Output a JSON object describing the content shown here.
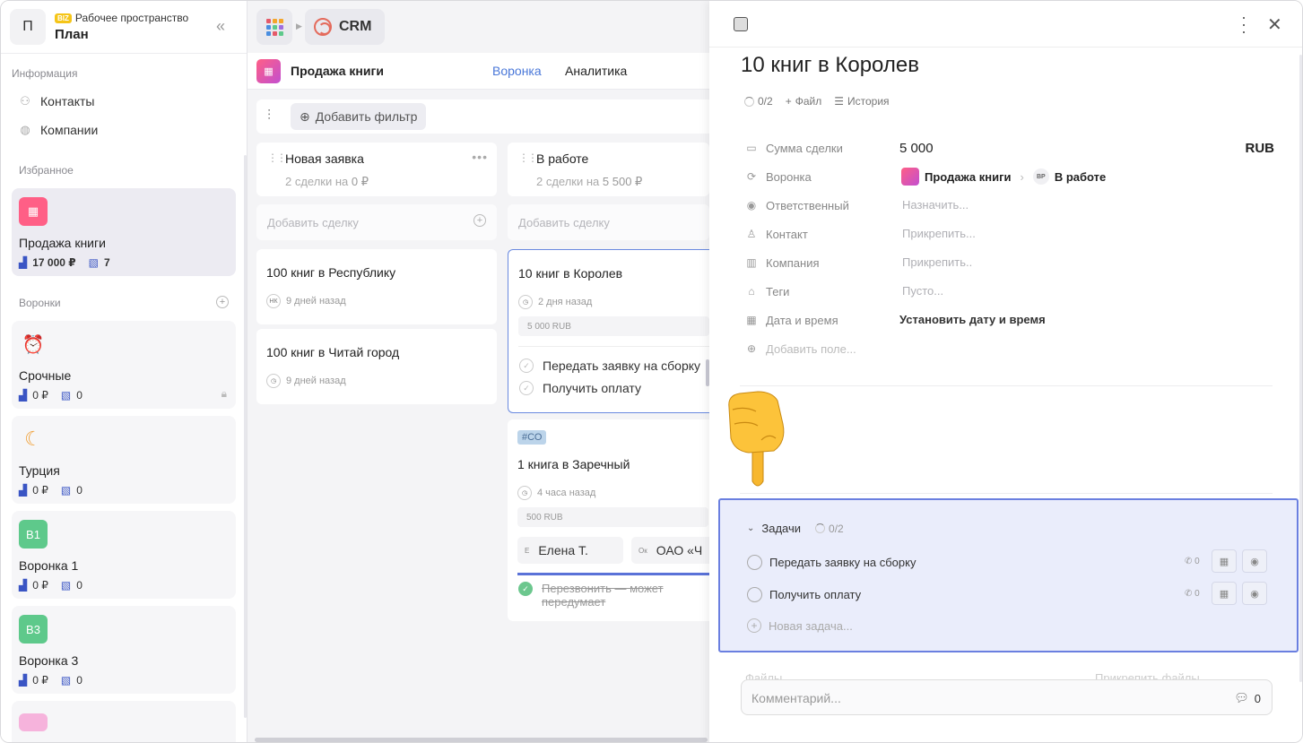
{
  "workspace": {
    "avatar_letter": "П",
    "badge": "BIZ",
    "subtitle": "Рабочее пространство",
    "title": "План"
  },
  "sidebar": {
    "section_info": "Информация",
    "nav": [
      {
        "label": "Контакты",
        "icon": "contacts-icon"
      },
      {
        "label": "Компании",
        "icon": "globe-icon"
      }
    ],
    "section_favorites": "Избранное",
    "favorite": {
      "name": "Продажа книги",
      "amount": "17 000 ₽",
      "count": "7",
      "color": "#ff5f86"
    },
    "section_pipelines": "Воронки",
    "pipelines": [
      {
        "name": "Срочные",
        "amount": "0 ₽",
        "count": "0",
        "icon": "alarm-clock-icon",
        "locked": true
      },
      {
        "name": "Турция",
        "amount": "0 ₽",
        "count": "0",
        "icon": "crescent-moon-icon"
      },
      {
        "name": "Воронка 1",
        "amount": "0 ₽",
        "count": "0",
        "badge": "В1",
        "color": "#5ec98b"
      },
      {
        "name": "Воронка 3",
        "amount": "0 ₽",
        "count": "0",
        "badge": "В3",
        "color": "#5ec98b"
      }
    ]
  },
  "topbar": {
    "app_label": "CRM"
  },
  "pipeline_bar": {
    "name": "Продажа книги",
    "tabs": [
      "Воронка",
      "Аналитика"
    ],
    "active_tab": "Воронка",
    "accent": "#4a78d9"
  },
  "filter": {
    "add_label": "Добавить фильтр"
  },
  "columns": [
    {
      "name": "Новая заявка",
      "summary_prefix": "2 сделки на",
      "summary_value": "0 ₽",
      "add_label": "Добавить сделку"
    },
    {
      "name": "В работе",
      "summary_prefix": "2 сделки на",
      "summary_value": "5 500 ₽",
      "add_label": "Добавить сделку"
    }
  ],
  "deals_col1": [
    {
      "name": "100 книг в Республику",
      "avatar": "НК",
      "time": "9 дней назад"
    },
    {
      "name": "100 книг в Читай город",
      "time": "9 дней назад"
    }
  ],
  "deal_active": {
    "name": "10 книг в Королев",
    "time": "2 дня назад",
    "amount": "5 000 RUB",
    "tasks": [
      "Передать заявку на сборку",
      "Получить оплату"
    ]
  },
  "deal_second": {
    "tag": "#СО",
    "name": "1 книга в Заречный",
    "time": "4 часа назад",
    "amount": "500 RUB",
    "contact_initial": "Е",
    "contact": "Елена Т.",
    "company_initial": "Ок",
    "company": "ОАО «Ч",
    "done_task": "Перезвонить — может передумает"
  },
  "detail": {
    "title": "10 книг в Королев",
    "meta": {
      "progress": "0/2",
      "file": "Файл",
      "history": "История"
    },
    "fields": {
      "sum_label": "Сумма сделки",
      "sum_value": "5 000",
      "currency": "RUB",
      "pipeline_label": "Воронка",
      "pipeline_value": "Продажа книги",
      "stage_badge": "ВР",
      "stage_value": "В работе",
      "owner_label": "Ответственный",
      "owner_value": "Назначить...",
      "contact_label": "Контакт",
      "contact_value": "Прикрепить...",
      "company_label": "Компания",
      "company_value": "Прикрепить..",
      "tags_label": "Теги",
      "tags_value": "Пусто...",
      "date_label": "Дата и время",
      "date_value": "Установить дату и время",
      "add_field": "Добавить поле..."
    },
    "tasks": {
      "title": "Задачи",
      "progress": "0/2",
      "items": [
        {
          "label": "Передать заявку на сборку",
          "calls": "0"
        },
        {
          "label": "Получить оплату",
          "calls": "0"
        }
      ],
      "new_task": "Новая задача..."
    },
    "files_ghost": {
      "label": "Файлы",
      "attach": "Прикрепить файлы"
    },
    "comment": {
      "placeholder": "Комментарий...",
      "count": "0"
    }
  }
}
